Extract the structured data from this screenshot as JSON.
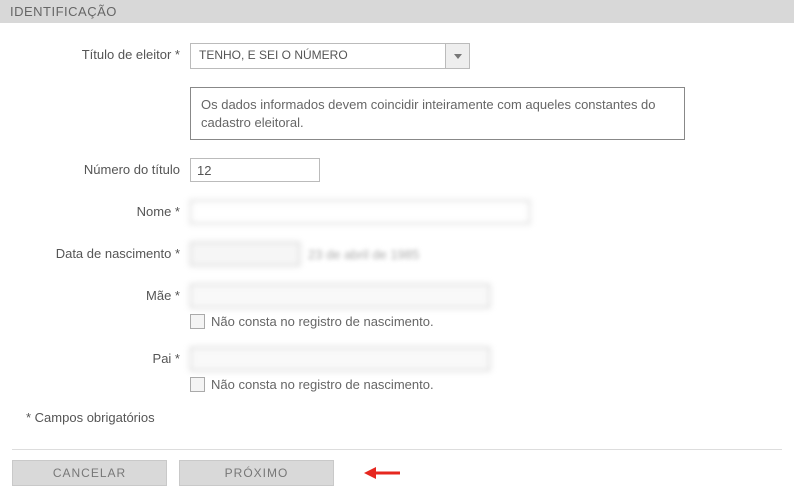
{
  "section": {
    "title": "IDENTIFICAÇÃO"
  },
  "fields": {
    "titulo": {
      "label": "Título de eleitor *",
      "selected": "TENHO, E SEI O NÚMERO"
    },
    "info_text": "Os dados informados devem coincidir inteiramente com aqueles constantes do cadastro eleitoral.",
    "numero": {
      "label": "Número do título",
      "value": "12"
    },
    "nome": {
      "label": "Nome *",
      "value": ""
    },
    "nascimento": {
      "label": "Data de nascimento *",
      "value": "",
      "formatted": "23 de abril de 1985"
    },
    "mae": {
      "label": "Mãe *",
      "value": "",
      "checkbox_label": "Não consta no registro de nascimento."
    },
    "pai": {
      "label": "Pai *",
      "value": "",
      "checkbox_label": "Não consta no registro de nascimento."
    }
  },
  "required_note": "* Campos obrigatórios",
  "buttons": {
    "cancel": "CANCELAR",
    "next": "PRÓXIMO"
  }
}
